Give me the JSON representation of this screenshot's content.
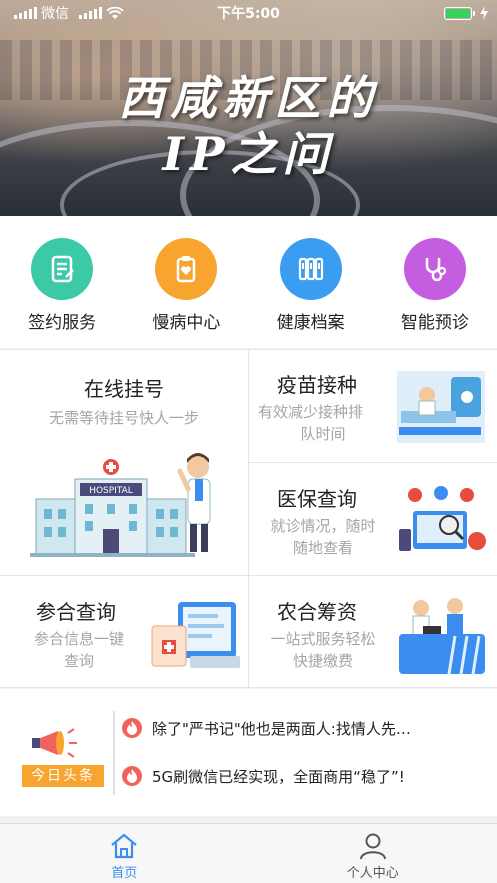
{
  "status_bar": {
    "carrier": "微信",
    "time": "下午5:00"
  },
  "banner": {
    "title_line1": "西咸新区的",
    "title_line2": "IP之问"
  },
  "quick_actions": [
    {
      "label": "签约服务",
      "icon": "document-edit-icon",
      "color": "#3cc9a5"
    },
    {
      "label": "慢病中心",
      "icon": "clipboard-heart-icon",
      "color": "#f7a52e"
    },
    {
      "label": "健康档案",
      "icon": "archive-icon",
      "color": "#3b9df2"
    },
    {
      "label": "智能预诊",
      "icon": "stethoscope-icon",
      "color": "#c45de0"
    }
  ],
  "services": {
    "online_registration": {
      "title": "在线挂号",
      "subtitle": "无需等待挂号快人一步",
      "sign": "HOSPITAL"
    },
    "vaccination": {
      "title": "疫苗接种",
      "subtitle_line1": "有效减少接种排",
      "subtitle_line2": "队时间"
    },
    "insurance_query": {
      "title": "医保查询",
      "subtitle_line1": "就诊情况，随时",
      "subtitle_line2": "随地查看"
    },
    "coop_query": {
      "title": "参合查询",
      "subtitle_line1": "参合信息一键",
      "subtitle_line2": "查询"
    },
    "coop_funding": {
      "title": "农合筹资",
      "subtitle_line1": "一站式服务轻松",
      "subtitle_line2": "快捷缴费"
    }
  },
  "news": {
    "brand_label": "今日头条",
    "items": [
      {
        "text": "除了\"严书记\"他也是两面人:找情人先…"
      },
      {
        "text": "5G刷微信已经实现，全面商用“稳了”!"
      }
    ]
  },
  "tabbar": {
    "tabs": [
      {
        "label": "首页",
        "icon": "home-icon",
        "active": true
      },
      {
        "label": "个人中心",
        "icon": "person-icon",
        "active": false
      }
    ],
    "active_color": "#3b8df0",
    "inactive_color": "#555555"
  }
}
